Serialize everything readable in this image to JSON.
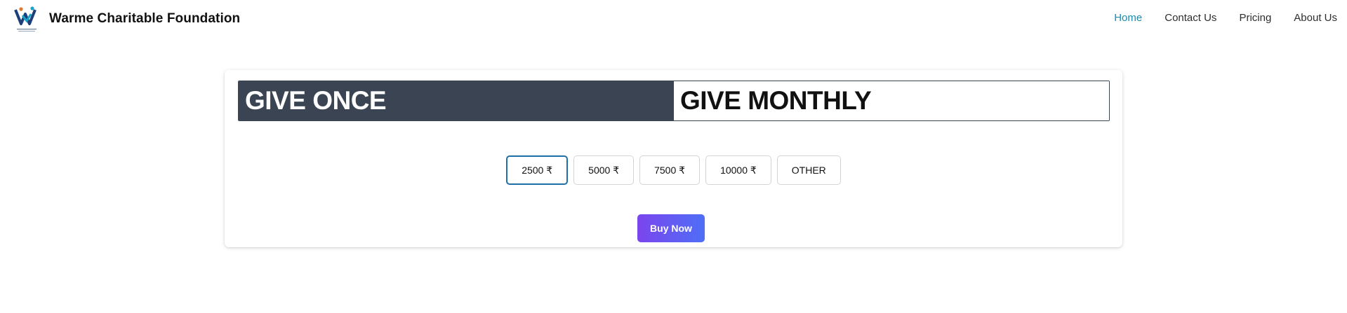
{
  "header": {
    "brand": "Warme Charitable Foundation",
    "logo_icon": "charity-people-logo-icon",
    "nav": [
      {
        "label": "Home",
        "active": true
      },
      {
        "label": "Contact Us",
        "active": false
      },
      {
        "label": "Pricing",
        "active": false
      },
      {
        "label": "About Us",
        "active": false
      }
    ]
  },
  "donation": {
    "tabs": [
      {
        "label": "GIVE ONCE",
        "active": true
      },
      {
        "label": "GIVE MONTHLY",
        "active": false
      }
    ],
    "amounts": [
      {
        "label": "2500 ₹",
        "selected": true
      },
      {
        "label": "5000 ₹",
        "selected": false
      },
      {
        "label": "7500 ₹",
        "selected": false
      },
      {
        "label": "10000 ₹",
        "selected": false
      },
      {
        "label": "OTHER",
        "selected": false
      }
    ],
    "buy_label": "Buy Now"
  },
  "colors": {
    "accent_link": "#1a8cb0",
    "tab_active_bg": "#3a4453",
    "selected_border": "#1f6fa8",
    "button_gradient_start": "#7b45ee",
    "button_gradient_end": "#4f6ef7"
  }
}
